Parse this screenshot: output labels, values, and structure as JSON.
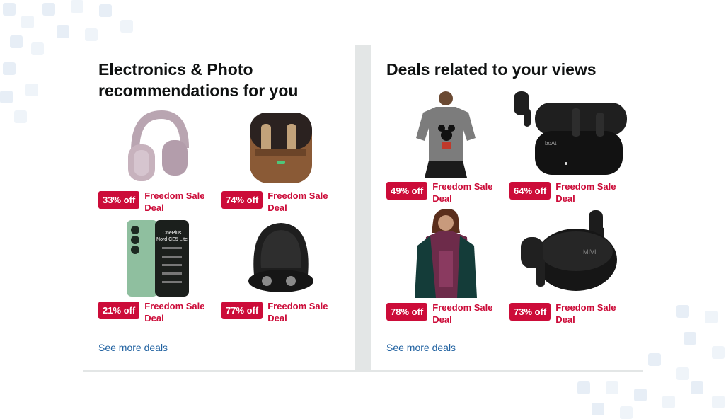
{
  "left_card": {
    "title": "Electronics & Photo recommendations for you",
    "see_more": "See more deals",
    "items": [
      {
        "discount": "33% off",
        "label": "Freedom Sale Deal",
        "image": "over-ear-headphones-pink"
      },
      {
        "discount": "74% off",
        "label": "Freedom Sale Deal",
        "image": "earbuds-brown-case"
      },
      {
        "discount": "21% off",
        "label": "Freedom Sale Deal",
        "image": "oneplus-nord-ce5-lite-phone",
        "image_text": [
          "OnePlus",
          "Nord CE5 Lite"
        ]
      },
      {
        "discount": "77% off",
        "label": "Freedom Sale Deal",
        "image": "headphone-carry-case"
      }
    ]
  },
  "right_card": {
    "title": "Deals related to your views",
    "see_more": "See more deals",
    "items": [
      {
        "discount": "49% off",
        "label": "Freedom Sale Deal",
        "image": "mickey-tshirt-model"
      },
      {
        "discount": "64% off",
        "label": "Freedom Sale Deal",
        "image": "earbuds-black-case",
        "image_text": "boAt"
      },
      {
        "discount": "78% off",
        "label": "Freedom Sale Deal",
        "image": "kurta-set-model"
      },
      {
        "discount": "73% off",
        "label": "Freedom Sale Deal",
        "image": "earbuds-black-round-case",
        "image_text": "MIVI"
      }
    ]
  },
  "colors": {
    "badge": "#cc0c39",
    "deal_text": "#cc0c39",
    "link": "#2162a1",
    "title": "#0f1111",
    "divider": "#e3e6e6"
  }
}
